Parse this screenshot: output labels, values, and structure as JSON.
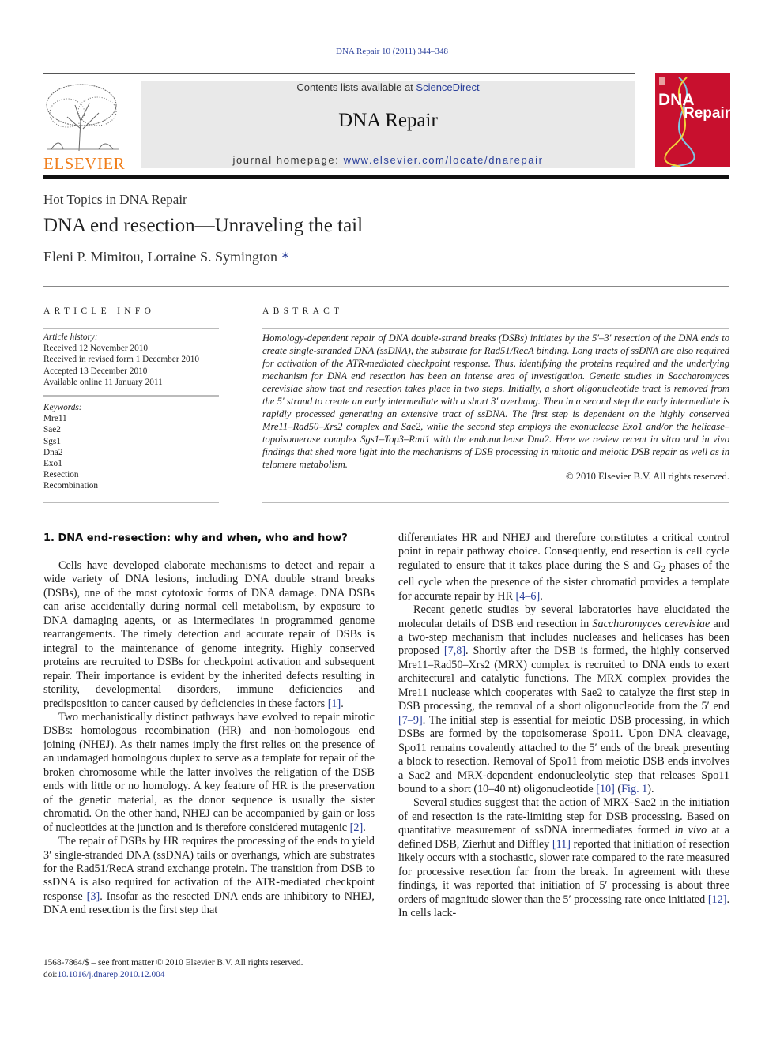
{
  "header": {
    "citation": "DNA Repair 10 (2011) 344–348",
    "contents_prefix": "Contents lists available at ",
    "contents_link": "ScienceDirect",
    "journal_title": "DNA Repair",
    "homepage_prefix": "journal homepage: ",
    "homepage_link": "www.elsevier.com/locate/dnarepair",
    "publisher_logo": "ELSEVIER",
    "cover_line1": "DNA",
    "cover_line2": "Repair"
  },
  "article": {
    "section": "Hot Topics in DNA Repair",
    "title": "DNA end resection—Unraveling the tail",
    "authors": "Eleni P. Mimitou, Lorraine S. Symington",
    "author_mark": "∗"
  },
  "article_info": {
    "heading": "ARTICLE INFO",
    "history_label": "Article history:",
    "history": [
      "Received 12 November 2010",
      "Received in revised form 1 December 2010",
      "Accepted 13 December 2010",
      "Available online 11 January 2011"
    ],
    "keywords_label": "Keywords:",
    "keywords": [
      "Mre11",
      "Sae2",
      "Sgs1",
      "Dna2",
      "Exo1",
      "Resection",
      "Recombination"
    ]
  },
  "abstract": {
    "heading": "ABSTRACT",
    "text": "Homology-dependent repair of DNA double-strand breaks (DSBs) initiates by the 5′–3′ resection of the DNA ends to create single-stranded DNA (ssDNA), the substrate for Rad51/RecA binding. Long tracts of ssDNA are also required for activation of the ATR-mediated checkpoint response. Thus, identifying the proteins required and the underlying mechanism for DNA end resection has been an intense area of investigation. Genetic studies in Saccharomyces cerevisiae show that end resection takes place in two steps. Initially, a short oligonucleotide tract is removed from the 5′ strand to create an early intermediate with a short 3′ overhang. Then in a sec­ond step the early intermediate is rapidly processed generating an extensive tract of ssDNA. The first step is dependent on the highly conserved Mre11–Rad50–Xrs2 complex and Sae2, while the second step employs the exonuclease Exo1 and/or the helicase–topoisomerase complex Sgs1–Top3–Rmi1 with the endonuclease Dna2. Here we review recent in vitro and in vivo findings that shed more light into the mechanisms of DSB processing in mitotic and meiotic DSB repair as well as in telomere metabolism.",
    "copyright": "© 2010 Elsevier B.V. All rights reserved."
  },
  "body": {
    "section_heading": "1.  DNA end-resection: why and when, who and how?",
    "left": [
      {
        "cont": false,
        "segs": [
          {
            "t": "Cells have developed elaborate mechanisms to detect and repair a wide variety of DNA lesions, including DNA double strand breaks (DSBs), one of the most cytotoxic forms of DNA damage. DNA DSBs can arise accidentally during normal cell metabolism, by expo­sure to DNA damaging agents, or as intermediates in programmed genome rearrangements. The timely detection and accurate repair of DSBs is integral to the maintenance of genome integrity. Highly conserved proteins are recruited to DSBs for checkpoint activation and subsequent repair. Their importance is evident by the inher­ited defects resulting in sterility, developmental disorders, immune deficiencies and predisposition to cancer caused by deficiencies in these factors "
          },
          {
            "t": "[1]",
            "ref": true
          },
          {
            "t": "."
          }
        ]
      },
      {
        "cont": false,
        "segs": [
          {
            "t": "Two mechanistically distinct pathways have evolved to repair mitotic DSBs: homologous recombination (HR) and non-homologous end joining (NHEJ). As their names imply the first relies on the presence of an undamaged homologous duplex to serve as a template for repair of the broken chromosome while the latter involves the religation of the DSB ends with little or no homology. A key feature of HR is the preservation of the genetic material, as the donor sequence is usually the sister chromatid. On the other hand, NHEJ can be accompanied by gain or loss of nucleotides at the junction and is therefore considered mutagenic "
          },
          {
            "t": "[2]",
            "ref": true
          },
          {
            "t": "."
          }
        ]
      },
      {
        "cont": false,
        "segs": [
          {
            "t": "The repair of DSBs by HR requires the processing of the ends to yield 3′ single-stranded DNA (ssDNA) tails or overhangs, which are substrates for the Rad51/RecA strand exchange protein. The transition from DSB to ssDNA is also required for activation of the ATR-mediated checkpoint response "
          },
          {
            "t": "[3]",
            "ref": true
          },
          {
            "t": ". Insofar as the resected DNA ends are inhibitory to NHEJ, DNA end resection is the first step that"
          }
        ]
      }
    ],
    "right": [
      {
        "cont": true,
        "segs": [
          {
            "t": "differentiates HR and NHEJ and therefore constitutes a critical con­trol point in repair pathway choice. Consequently, end resection is cell cycle regulated to ensure that it takes place during the S and G"
          },
          {
            "t": "2",
            "sub": true
          },
          {
            "t": " phases of the cell cycle when the presence of the sister chromatid provides a template for accurate repair by HR "
          },
          {
            "t": "[4–6]",
            "ref": true
          },
          {
            "t": "."
          }
        ]
      },
      {
        "cont": false,
        "segs": [
          {
            "t": "Recent genetic studies by several laboratories have elucidated the molecular details of DSB end resection in "
          },
          {
            "t": "Saccharomyces cerevisiae",
            "i": true
          },
          {
            "t": " and a two-step mechanism that includes nucleases and helicases has been proposed "
          },
          {
            "t": "[7,8]",
            "ref": true
          },
          {
            "t": ". Shortly after the DSB is formed, the highly conserved Mre11–Rad50–Xrs2 (MRX) com­plex is recruited to DNA ends to exert architectural and catalytic functions. The MRX complex provides the Mre11 nuclease which cooperates with Sae2 to catalyze the first step in DSB process­ing, the removal of a short oligonucleotide from the 5′ end "
          },
          {
            "t": "[7–9]",
            "ref": true
          },
          {
            "t": ". The initial step is essential for meiotic DSB processing, in which DSBs are formed by the topoisomerase Spo11. Upon DNA cleavage, Spo11 remains covalently attached to the 5′ ends of the break pre­senting a block to resection. Removal of Spo11 from meiotic DSB ends involves a Sae2 and MRX-dependent endonucleolytic step that releases Spo11 bound to a short (10–40 nt) oligonucleotide "
          },
          {
            "t": "[10]",
            "ref": true
          },
          {
            "t": " ("
          },
          {
            "t": "Fig. 1",
            "ref": true
          },
          {
            "t": ")."
          }
        ]
      },
      {
        "cont": false,
        "segs": [
          {
            "t": "Several studies suggest that the action of MRX–Sae2 in the initiation of end resection is the rate-limiting step for DSB process­ing. Based on quantitative measurement of ssDNA intermediates formed "
          },
          {
            "t": "in vivo",
            "i": true
          },
          {
            "t": " at a defined DSB, Zierhut and Diffley "
          },
          {
            "t": "[11]",
            "ref": true
          },
          {
            "t": " reported that initiation of resection likely occurs with a stochastic, slower rate compared to the rate measured for processive resection far from the break. In agreement with these findings, it was reported that initiation of 5′ processing is about three orders of magnitude slower than the 5′ processing rate once initiated "
          },
          {
            "t": "[12]",
            "ref": true
          },
          {
            "t": ". In cells lack-"
          }
        ]
      }
    ]
  },
  "footer": {
    "line1": "1568-7864/$ – see front matter © 2010 Elsevier B.V. All rights reserved.",
    "doi_prefix": "doi:",
    "doi": "10.1016/j.dnarep.2010.12.004"
  },
  "colors": {
    "link": "#2a3f9a",
    "elsevier_orange": "#f07f1d",
    "cover_red": "#c8102e",
    "header_box": "#e9e9e9"
  }
}
